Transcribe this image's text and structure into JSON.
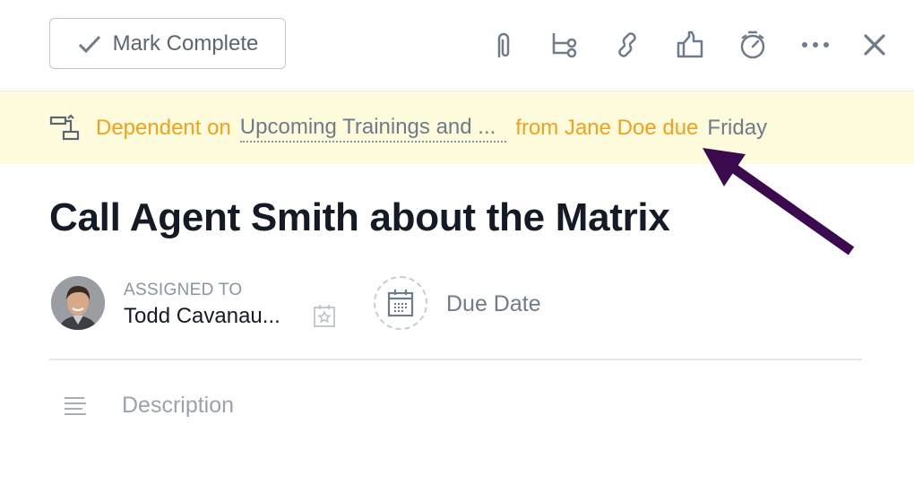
{
  "toolbar": {
    "mark_complete_label": "Mark Complete",
    "icons": [
      "paperclip-icon",
      "subtask-icon",
      "link-icon",
      "thumbs-up-icon",
      "stopwatch-icon",
      "more-icon",
      "close-icon"
    ]
  },
  "dependency_banner": {
    "prefix": "Dependent on",
    "task_link": "Upcoming Trainings and ...",
    "middle": "from Jane Doe due",
    "due": "Friday",
    "colors": {
      "background": "#fdfbdc",
      "accent": "#f3a01b",
      "link": "#6f7b89"
    }
  },
  "task": {
    "title": "Call Agent Smith about the Matrix",
    "assigned_label": "ASSIGNED TO",
    "assignee": "Todd Cavanau...",
    "due_date_label": "Due Date",
    "description_placeholder": "Description"
  },
  "annotation": {
    "arrow_color": "#3b0a4f"
  }
}
